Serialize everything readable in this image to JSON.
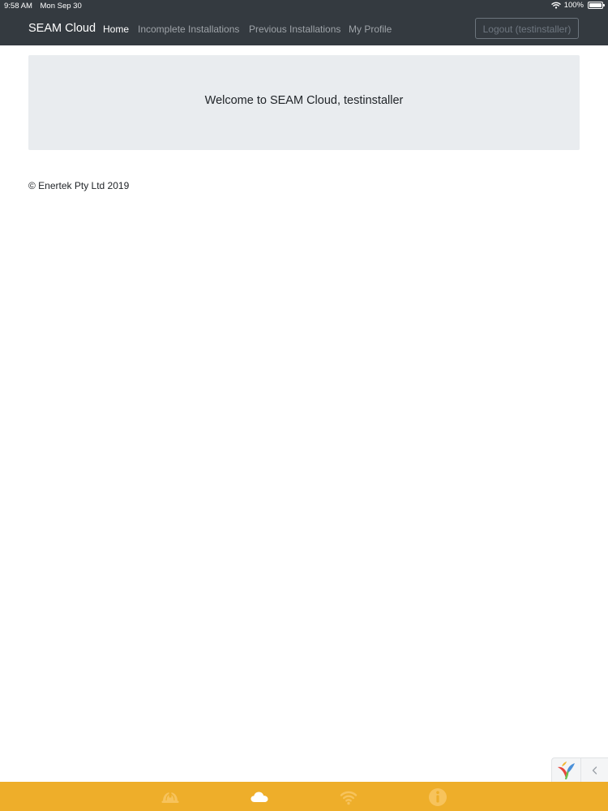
{
  "status_bar": {
    "time": "9:58 AM",
    "date": "Mon Sep 30",
    "battery": "100%"
  },
  "navbar": {
    "brand": "SEAM Cloud",
    "links": [
      "Home",
      "Incomplete Installations",
      "Previous Installations",
      "My Profile"
    ],
    "active_link": "Home",
    "logout_label": "Logout (testinstaller)"
  },
  "jumbotron": {
    "welcome_text": "Welcome to SEAM Cloud, testinstaller"
  },
  "footer": {
    "copyright": "© Enertek Pty Ltd 2019"
  },
  "tab_bar": {
    "color": "#eeae2a",
    "icons": [
      "helmet-icon",
      "cloud-icon",
      "wifi-icon",
      "info-icon"
    ]
  },
  "colors": {
    "navbar_bg": "#343a40",
    "jumbotron_bg": "#e9ecef",
    "accent": "#eeae2a"
  }
}
